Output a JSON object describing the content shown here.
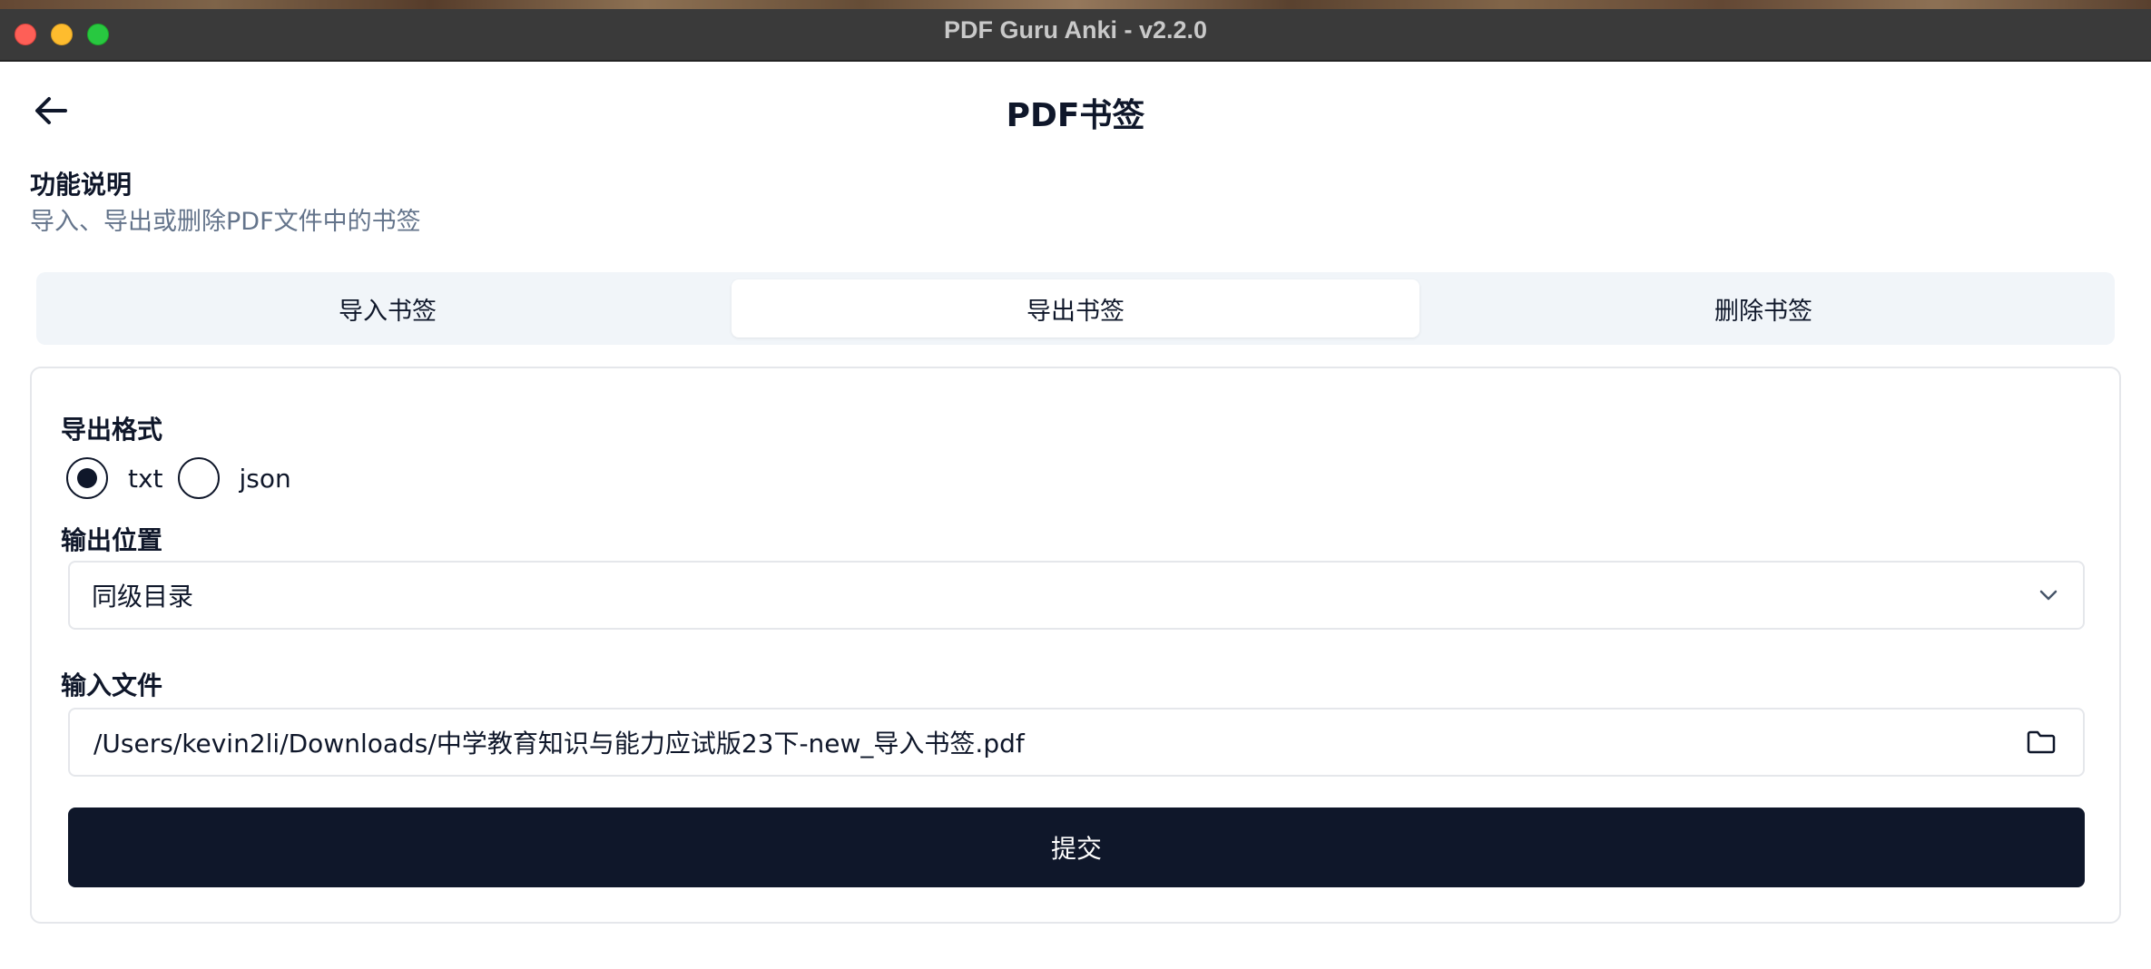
{
  "window": {
    "title": "PDF Guru Anki - v2.2.0"
  },
  "header": {
    "title": "PDF书签",
    "back_icon": "arrow-left-icon"
  },
  "description": {
    "title": "功能说明",
    "text": "导入、导出或删除PDF文件中的书签"
  },
  "tabs": [
    {
      "label": "导入书签",
      "active": false
    },
    {
      "label": "导出书签",
      "active": true
    },
    {
      "label": "删除书签",
      "active": false
    }
  ],
  "form": {
    "format_label": "导出格式",
    "format_options": [
      {
        "label": "txt",
        "selected": true
      },
      {
        "label": "json",
        "selected": false
      }
    ],
    "output_label": "输出位置",
    "output_value": "同级目录",
    "input_label": "输入文件",
    "input_value": "/Users/kevin2li/Downloads/中学教育知识与能力应试版23下-new_导入书签.pdf",
    "submit_label": "提交"
  },
  "colors": {
    "primary": "#0f172a",
    "muted": "#64748b",
    "tab_bg": "#f1f5f9",
    "border": "#e5e7eb"
  }
}
